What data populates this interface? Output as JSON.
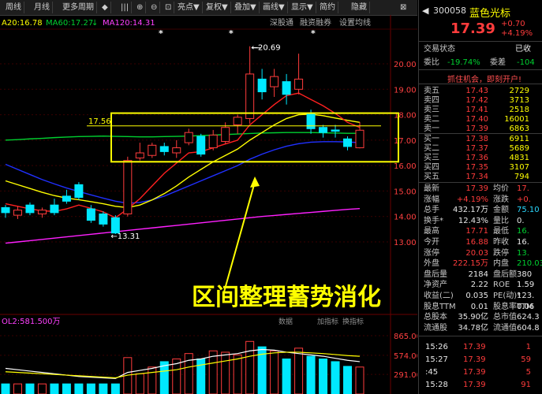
{
  "toolbar": {
    "items": [
      "周线",
      "月线",
      "更多周期",
      "◆",
      "|||",
      "⊕",
      "⊖",
      "⊡",
      "亮点",
      "复权",
      "叠加",
      "画线",
      "显示",
      "简约",
      "隐藏"
    ],
    "arrows": [
      "▼",
      "▼",
      "▼",
      "▼",
      "▼"
    ]
  },
  "indicators": {
    "ma_partial": "A20:16.78",
    "ma60": "MA60:17.27",
    "ma120": "MA120:14.31",
    "links": [
      "深股通",
      "融资融券",
      "设置均线"
    ]
  },
  "annotations": {
    "high_label": "20.69",
    "low_label": "13.31",
    "box_level": "17.56",
    "caption": "区间整理蓄势消化",
    "star_marks": [
      "*",
      "*",
      "*"
    ]
  },
  "volume_panel": {
    "label": "OL2:581.500万",
    "links": [
      "数据",
      "加指标",
      "换指标"
    ]
  },
  "chart_data": {
    "type": "candlestick",
    "title": "",
    "y_ticks": [
      20.0,
      19.0,
      18.0,
      17.0,
      16.0,
      15.0,
      14.0,
      13.0
    ],
    "y_range": [
      12.4,
      20.9
    ],
    "candles": [
      {
        "o": 14.35,
        "c": 14.15,
        "h": 14.45,
        "l": 13.95
      },
      {
        "o": 14.05,
        "c": 14.25,
        "h": 14.4,
        "l": 13.9
      },
      {
        "o": 14.45,
        "c": 14.15,
        "h": 14.55,
        "l": 14.05
      },
      {
        "o": 14.1,
        "c": 14.25,
        "h": 14.35,
        "l": 13.95
      },
      {
        "o": 14.45,
        "c": 14.15,
        "h": 14.7,
        "l": 14.05
      },
      {
        "o": 14.8,
        "c": 14.6,
        "h": 15.05,
        "l": 14.5
      },
      {
        "o": 15.25,
        "c": 14.75,
        "h": 15.35,
        "l": 14.65
      },
      {
        "o": 14.3,
        "c": 13.85,
        "h": 14.45,
        "l": 13.75
      },
      {
        "o": 14.1,
        "c": 13.7,
        "h": 14.2,
        "l": 13.6
      },
      {
        "o": 13.95,
        "c": 13.35,
        "h": 14.05,
        "l": 13.31
      },
      {
        "o": 14.1,
        "c": 16.2,
        "h": 16.35,
        "l": 14.0
      },
      {
        "o": 16.3,
        "c": 16.5,
        "h": 16.9,
        "l": 16.2
      },
      {
        "o": 16.4,
        "c": 16.8,
        "h": 16.9,
        "l": 16.3
      },
      {
        "o": 16.75,
        "c": 16.55,
        "h": 16.9,
        "l": 16.4
      },
      {
        "o": 16.5,
        "c": 16.7,
        "h": 17.0,
        "l": 16.3
      },
      {
        "o": 16.9,
        "c": 17.3,
        "h": 17.45,
        "l": 16.8
      },
      {
        "o": 17.15,
        "c": 16.45,
        "h": 17.25,
        "l": 16.35
      },
      {
        "o": 16.7,
        "c": 17.2,
        "h": 17.4,
        "l": 16.6
      },
      {
        "o": 16.95,
        "c": 17.5,
        "h": 17.7,
        "l": 16.85
      },
      {
        "o": 17.6,
        "c": 17.9,
        "h": 18.0,
        "l": 17.25
      },
      {
        "o": 17.85,
        "c": 19.6,
        "h": 20.69,
        "l": 17.65
      },
      {
        "o": 19.4,
        "c": 18.9,
        "h": 19.8,
        "l": 18.6
      },
      {
        "o": 19.1,
        "c": 19.5,
        "h": 19.8,
        "l": 18.7
      },
      {
        "o": 19.3,
        "c": 18.8,
        "h": 19.6,
        "l": 18.4
      },
      {
        "o": 19.0,
        "c": 19.4,
        "h": 20.4,
        "l": 18.8
      },
      {
        "o": 18.05,
        "c": 17.45,
        "h": 18.2,
        "l": 17.25
      },
      {
        "o": 17.5,
        "c": 17.3,
        "h": 17.6,
        "l": 17.1
      },
      {
        "o": 17.4,
        "c": 17.35,
        "h": 17.6,
        "l": 17.1
      },
      {
        "o": 17.05,
        "c": 16.75,
        "h": 17.15,
        "l": 16.6
      },
      {
        "o": 16.7,
        "c": 17.39,
        "h": 17.71,
        "l": 16.68
      }
    ],
    "ma5": [
      14.5,
      14.4,
      14.3,
      14.22,
      14.2,
      14.3,
      14.45,
      14.32,
      14.18,
      13.95,
      14.3,
      14.7,
      15.2,
      15.7,
      16.1,
      16.5,
      16.55,
      16.7,
      16.85,
      17.0,
      17.6,
      18.0,
      18.4,
      18.75,
      18.85,
      18.6,
      18.35,
      18.05,
      17.7,
      17.5
    ],
    "ma20": [
      15.4,
      15.25,
      15.1,
      14.95,
      14.82,
      14.72,
      14.66,
      14.58,
      14.5,
      14.4,
      14.35,
      14.45,
      14.65,
      14.9,
      15.2,
      15.55,
      15.85,
      16.15,
      16.4,
      16.65,
      17.0,
      17.3,
      17.6,
      17.85,
      18.0,
      18.02,
      17.96,
      17.87,
      17.78,
      17.7
    ],
    "ma30": [
      16.05,
      15.85,
      15.65,
      15.45,
      15.28,
      15.12,
      14.98,
      14.85,
      14.72,
      14.6,
      14.52,
      14.55,
      14.65,
      14.8,
      15.0,
      15.2,
      15.4,
      15.6,
      15.8,
      16.0,
      16.25,
      16.45,
      16.62,
      16.76,
      16.86,
      16.92,
      16.94,
      16.94,
      16.93,
      16.9
    ],
    "ma60": [
      17.0,
      17.02,
      17.05,
      17.07,
      17.1,
      17.12,
      17.14,
      17.15,
      17.16,
      17.15,
      17.14,
      17.13,
      17.13,
      17.14,
      17.15,
      17.16,
      17.18,
      17.2,
      17.22,
      17.24,
      17.26,
      17.28,
      17.29,
      17.3,
      17.3,
      17.3,
      17.29,
      17.28,
      17.27,
      17.27
    ],
    "ma120": [
      12.95,
      13.0,
      13.05,
      13.1,
      13.15,
      13.2,
      13.25,
      13.3,
      13.35,
      13.4,
      13.45,
      13.5,
      13.55,
      13.6,
      13.65,
      13.7,
      13.75,
      13.8,
      13.85,
      13.9,
      13.95,
      14.0,
      14.04,
      14.08,
      14.12,
      14.16,
      14.2,
      14.24,
      14.28,
      14.31
    ],
    "volume_ticks": [
      865.0,
      574.0,
      291.0
    ],
    "volume_unit": "万",
    "volumes": [
      150,
      150,
      150,
      150,
      150,
      150,
      150,
      150,
      150,
      150,
      540,
      300,
      400,
      480,
      520,
      600,
      520,
      640,
      620,
      580,
      780,
      700,
      640,
      520,
      680,
      560,
      520,
      480,
      410,
      400
    ],
    "vol_ma5": [
      380,
      360,
      340,
      320,
      300,
      280,
      260,
      250,
      240,
      230,
      320,
      350,
      380,
      420,
      450,
      500,
      520,
      560,
      580,
      600,
      640,
      660,
      650,
      620,
      600,
      580,
      560,
      530,
      500,
      480
    ],
    "vol_ma10": [
      330,
      320,
      310,
      300,
      290,
      280,
      270,
      260,
      250,
      240,
      280,
      300,
      320,
      340,
      360,
      400,
      430,
      460,
      490,
      520,
      560,
      590,
      610,
      620,
      620,
      610,
      600,
      585,
      570,
      560
    ]
  },
  "quote": {
    "code": "300058",
    "name": "蓝色光标",
    "price": "17.39",
    "change": "+0.70",
    "change_pct": "+4.19%",
    "status_label": "交易状态",
    "status_value": "已收",
    "weibi_label": "委比",
    "weibi_value": "-19.74%",
    "weicha_label": "委差",
    "weicha_value": "-104",
    "banner": "抓住机会，即刻开户!",
    "asks": [
      {
        "label": "卖五",
        "price": "17.43",
        "vol": "2729"
      },
      {
        "label": "卖四",
        "price": "17.42",
        "vol": "3713"
      },
      {
        "label": "卖三",
        "price": "17.41",
        "vol": "2518"
      },
      {
        "label": "卖二",
        "price": "17.40",
        "vol": "16001"
      },
      {
        "label": "卖一",
        "price": "17.39",
        "vol": "6863"
      }
    ],
    "bids": [
      {
        "label": "买一",
        "price": "17.38",
        "vol": "6911"
      },
      {
        "label": "买二",
        "price": "17.37",
        "vol": "5689"
      },
      {
        "label": "买三",
        "price": "17.36",
        "vol": "4831"
      },
      {
        "label": "买四",
        "price": "17.35",
        "vol": "3107"
      },
      {
        "label": "买五",
        "price": "17.34",
        "vol": "794"
      }
    ],
    "stats": [
      {
        "l1": "最新",
        "v1": "17.39",
        "k1": "red",
        "l2": "均价",
        "v2": "17.",
        "k2": "red"
      },
      {
        "l1": "涨幅",
        "v1": "+4.19%",
        "k1": "red",
        "l2": "涨跌",
        "v2": "+0.",
        "k2": "red"
      },
      {
        "l1": "总手",
        "v1": "432.17万",
        "k1": "wht",
        "l2": "金额",
        "v2": "75.10",
        "k2": "cyan"
      },
      {
        "l1": "换手*",
        "v1": "12.43%",
        "k1": "wht",
        "l2": "量比",
        "v2": "0.",
        "k2": "wht"
      },
      {
        "l1": "最高",
        "v1": "17.71",
        "k1": "red",
        "l2": "最低",
        "v2": "16.",
        "k2": "grn"
      },
      {
        "l1": "今开",
        "v1": "16.88",
        "k1": "red",
        "l2": "昨收",
        "v2": "16.",
        "k2": "wht"
      },
      {
        "l1": "涨停",
        "v1": "20.03",
        "k1": "red",
        "l2": "跌停",
        "v2": "13.",
        "k2": "grn"
      },
      {
        "l1": "外盘",
        "v1": "222.15万",
        "k1": "red",
        "l2": "内盘",
        "v2": "210.03",
        "k2": "grn"
      },
      {
        "l1": "盘后量",
        "v1": "2184",
        "k1": "wht",
        "l2": "盘后额",
        "v2": "380",
        "k2": "wht"
      },
      {
        "l1": "净资产",
        "v1": "2.22",
        "k1": "wht",
        "l2": "ROE",
        "v2": "1.59",
        "k2": "wht"
      },
      {
        "l1": "收益(二)",
        "v1": "0.035",
        "k1": "wht",
        "l2": "PE(动)*",
        "v2": "123.",
        "k2": "wht"
      },
      {
        "l1": "股息TTM",
        "v1": "0.01",
        "k1": "wht",
        "l2": "股息率TTM",
        "v2": "0.06",
        "k2": "wht"
      },
      {
        "l1": "总股本",
        "v1": "35.90亿",
        "k1": "wht",
        "l2": "总市值",
        "v2": "624.3",
        "k2": "wht"
      },
      {
        "l1": "流通股",
        "v1": "34.78亿",
        "k1": "wht",
        "l2": "流通值",
        "v2": "604.8",
        "k2": "wht"
      }
    ],
    "ticks": [
      {
        "time": "15:26",
        "price": "17.39",
        "vol": "1"
      },
      {
        "time": "15:27",
        "price": "17.39",
        "vol": "59"
      },
      {
        "time": ":45",
        "price": "17.39",
        "vol": "5"
      },
      {
        "time": "15:28",
        "price": "17.39",
        "vol": "91"
      }
    ]
  },
  "colors": {
    "up": "#ff3c3c",
    "down": "#00e8ff",
    "ma5": "#ff2020",
    "ma20": "#ffff00",
    "ma60": "#00d030",
    "ma30": "#2030ff",
    "ma120": "#ff20ff",
    "box": "#ffff00"
  }
}
